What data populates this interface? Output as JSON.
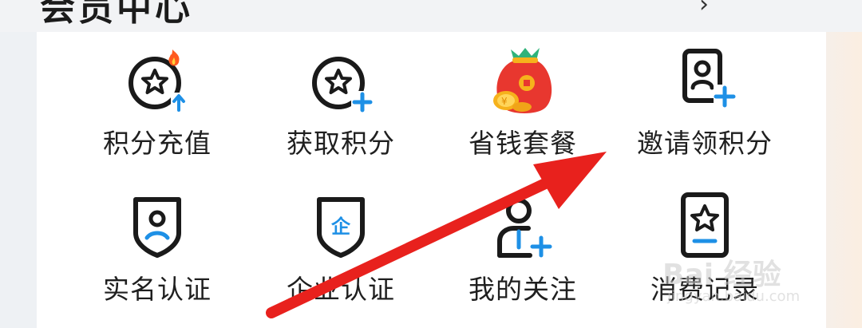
{
  "header": {
    "title_fragment": "会员中心",
    "chevron": "›"
  },
  "grid": {
    "row1": [
      {
        "label": "积分充值",
        "icon": "star-coin-up-icon"
      },
      {
        "label": "获取积分",
        "icon": "star-coin-plus-icon"
      },
      {
        "label": "省钱套餐",
        "icon": "money-bag-icon"
      },
      {
        "label": "邀请领积分",
        "icon": "invite-user-card-icon"
      }
    ],
    "row2": [
      {
        "label": "实名认证",
        "icon": "shield-user-icon"
      },
      {
        "label": "企业认证",
        "icon": "shield-enterprise-icon"
      },
      {
        "label": "我的关注",
        "icon": "user-follow-icon"
      },
      {
        "label": "消费记录",
        "icon": "star-record-icon"
      }
    ]
  },
  "watermark": {
    "text": "Bai 经验",
    "sub": "jingyan.baidu.com"
  },
  "colors": {
    "accent_blue": "#1e90e6",
    "icon_dark": "#1a1a1a",
    "arrow_red": "#e8211d",
    "bag_red": "#e8372f",
    "coin_gold": "#f6b21c"
  }
}
